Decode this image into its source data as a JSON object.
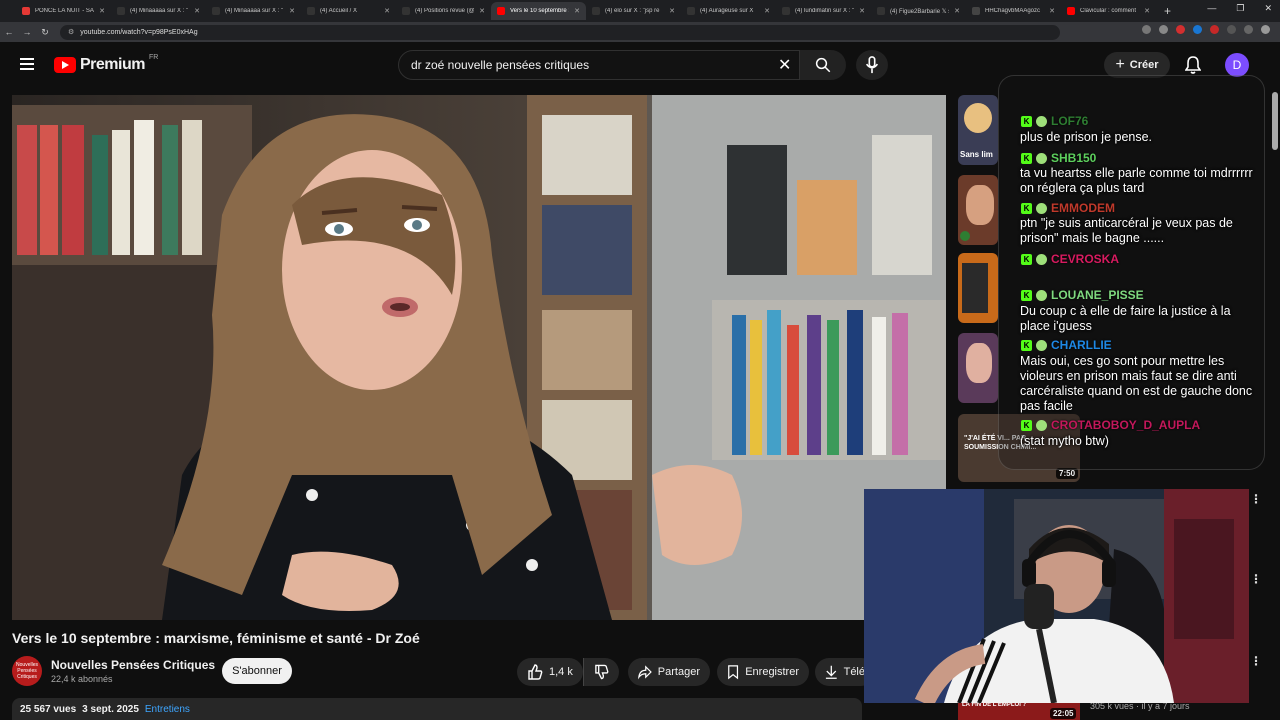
{
  "browser": {
    "tabs": [
      {
        "label": "PONCE LA NUIT - SAR",
        "color": "#e53935",
        "active": false
      },
      {
        "label": "(4) Minaaaaa sur X : \"",
        "color": "#333333",
        "active": false
      },
      {
        "label": "(4) Minaaaaa sur X : \"",
        "color": "#333333",
        "active": false
      },
      {
        "label": "(4) Accueil / X",
        "color": "#333333",
        "active": false
      },
      {
        "label": "(4) Positions revue (@",
        "color": "#333333",
        "active": false
      },
      {
        "label": "Vers le 10 septembre :",
        "color": "#ff0000",
        "active": true
      },
      {
        "label": "(4) elo sur X : \"jsp re",
        "color": "#333333",
        "active": false
      },
      {
        "label": "(4) Aurageuse sur X",
        "color": "#333333",
        "active": false
      },
      {
        "label": "(4) lundimatin sur X : \"",
        "color": "#333333",
        "active": false
      },
      {
        "label": "(4) Figue2Barbarie 𝕏 s",
        "color": "#333333",
        "active": false
      },
      {
        "label": "HHChagvbMAAgozc",
        "color": "#444444",
        "active": false
      },
      {
        "label": "Clavicular : comment",
        "color": "#ff0000",
        "active": false
      }
    ],
    "url": "youtube.com/watch?v=p98PsE0xHAg"
  },
  "header": {
    "logo_text": "Premium",
    "logo_region": "FR",
    "search_value": "dr zoé nouvelle pensées critiques",
    "create_label": "Créer",
    "avatar_letter": "D"
  },
  "video": {
    "title": "Vers le 10 septembre : marxisme, féminisme et santé - Dr Zoé",
    "channel_name": "Nouvelles Pensées Critiques",
    "channel_avatar_text": "Nouvelles Pensées Critiques",
    "subscribers": "22,4 k abonnés",
    "subscribe_label": "S'abonner",
    "likes": "1,4 k",
    "share_label": "Partager",
    "save_label": "Enregistrer",
    "download_label": "Télé",
    "views": "25 567 vues",
    "date": "3 sept. 2025",
    "tag": "Entretiens"
  },
  "sidebar": {
    "thumb1_label": "Sans lim",
    "thumb5_caption": "\"J'AI ÉTÉ VI... PAR SOUMISSION CHIMI...",
    "thumb5_duration": "7:50",
    "thumb6_duration": "22:05",
    "thumb6_meta": "305 k vues · il y a 7 jours",
    "thumb6_caption": "LA FIN DE L'EMPLOI ?"
  },
  "chat": {
    "messages": [
      {
        "user": "LOF76",
        "color": "#2e7d32",
        "text": "plus de prison je pense."
      },
      {
        "user": "SHB150",
        "color": "#5dd05d",
        "text": "ta vu heartss elle parle comme toi mdrrrrrr on réglera ça plus tard"
      },
      {
        "user": "EMMODEM",
        "color": "#c0392b",
        "text": "ptn \"je suis anticarcéral je veux pas de prison\" mais le bagne ......"
      },
      {
        "user": "CEVROSKA",
        "color": "#d81b60",
        "text": ""
      },
      {
        "user": "LOUANE_PISSE",
        "color": "#7fd97f",
        "text": "Du coup c à elle de faire la justice à la place i'guess"
      },
      {
        "user": "CHARLLIE",
        "color": "#1e88e5",
        "text": "Mais oui, ces go sont pour mettre les violeurs en prison mais faut se dire anti carcéraliste quand on est de gauche donc pas facile"
      },
      {
        "user": "CROTABOBOY_D_AUPLA",
        "color": "#c2185b",
        "text": "(stat mytho btw)"
      }
    ]
  }
}
